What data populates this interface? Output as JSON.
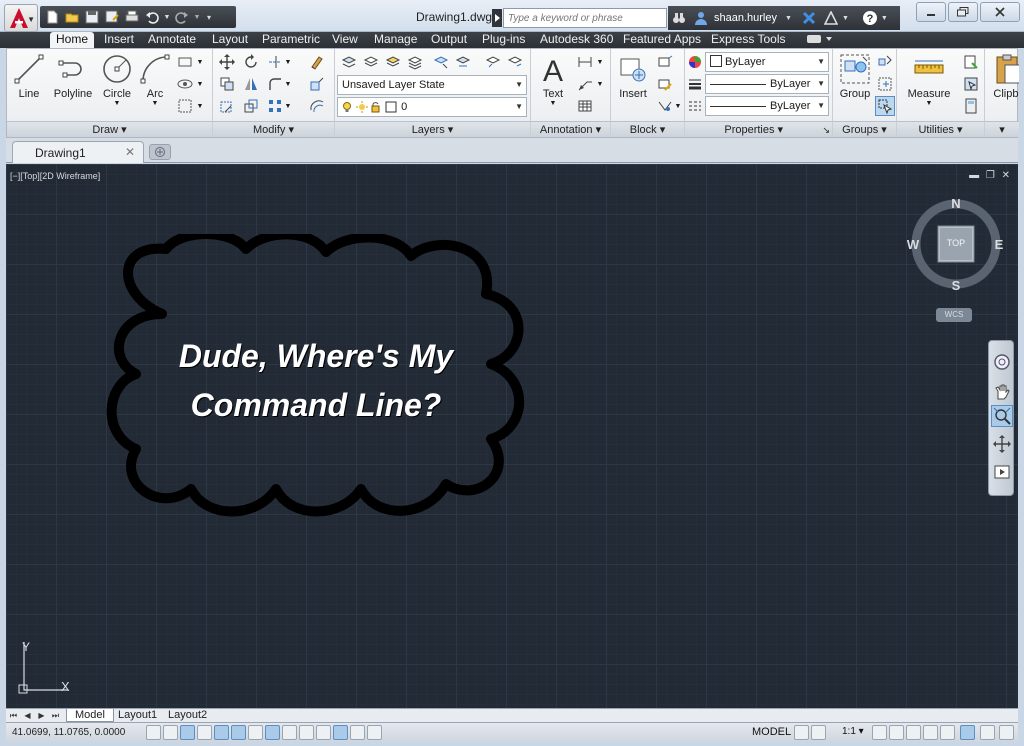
{
  "title_bar": {
    "document_title": "Drawing1.dwg",
    "search_placeholder": "Type a keyword or phrase",
    "user_name": "shaan.hurley"
  },
  "ribbon_tabs": [
    "Home",
    "Insert",
    "Annotate",
    "Layout",
    "Parametric",
    "View",
    "Manage",
    "Output",
    "Plug-ins",
    "Autodesk 360",
    "Featured Apps",
    "Express Tools"
  ],
  "ribbon": {
    "draw": {
      "title": "Draw",
      "line": "Line",
      "polyline": "Polyline",
      "circle": "Circle",
      "arc": "Arc"
    },
    "modify": {
      "title": "Modify"
    },
    "layers": {
      "title": "Layers",
      "layer_state": "Unsaved Layer State",
      "current_layer": "0"
    },
    "annotation": {
      "title": "Annotation",
      "text": "Text"
    },
    "block": {
      "title": "Block",
      "insert": "Insert"
    },
    "properties": {
      "title": "Properties",
      "color": "ByLayer",
      "linetype": "ByLayer",
      "lineweight": "ByLayer"
    },
    "groups": {
      "title": "Groups",
      "group": "Group"
    },
    "utilities": {
      "title": "Utilities",
      "measure": "Measure"
    },
    "clipboard": {
      "title": "Clipbo"
    }
  },
  "file_tabs": {
    "active": "Drawing1"
  },
  "viewport": {
    "label": "[−][Top][2D Wireframe]",
    "cloud_text_line1": "Dude, Where's My",
    "cloud_text_line2": "Command Line?",
    "viewcube": {
      "n": "N",
      "s": "S",
      "e": "E",
      "w": "W",
      "face": "TOP",
      "wcs": "WCS"
    },
    "ucs": {
      "x": "X",
      "y": "Y"
    }
  },
  "layout_tabs": [
    "Model",
    "Layout1",
    "Layout2"
  ],
  "status_bar": {
    "coordinates": "41.0699, 11.0765, 0.0000",
    "model": "MODEL",
    "scale": "1:1"
  },
  "colors": {
    "canvas": "#222a35",
    "ribbon_dark": "#2e3237",
    "accent": "#c8102e"
  }
}
